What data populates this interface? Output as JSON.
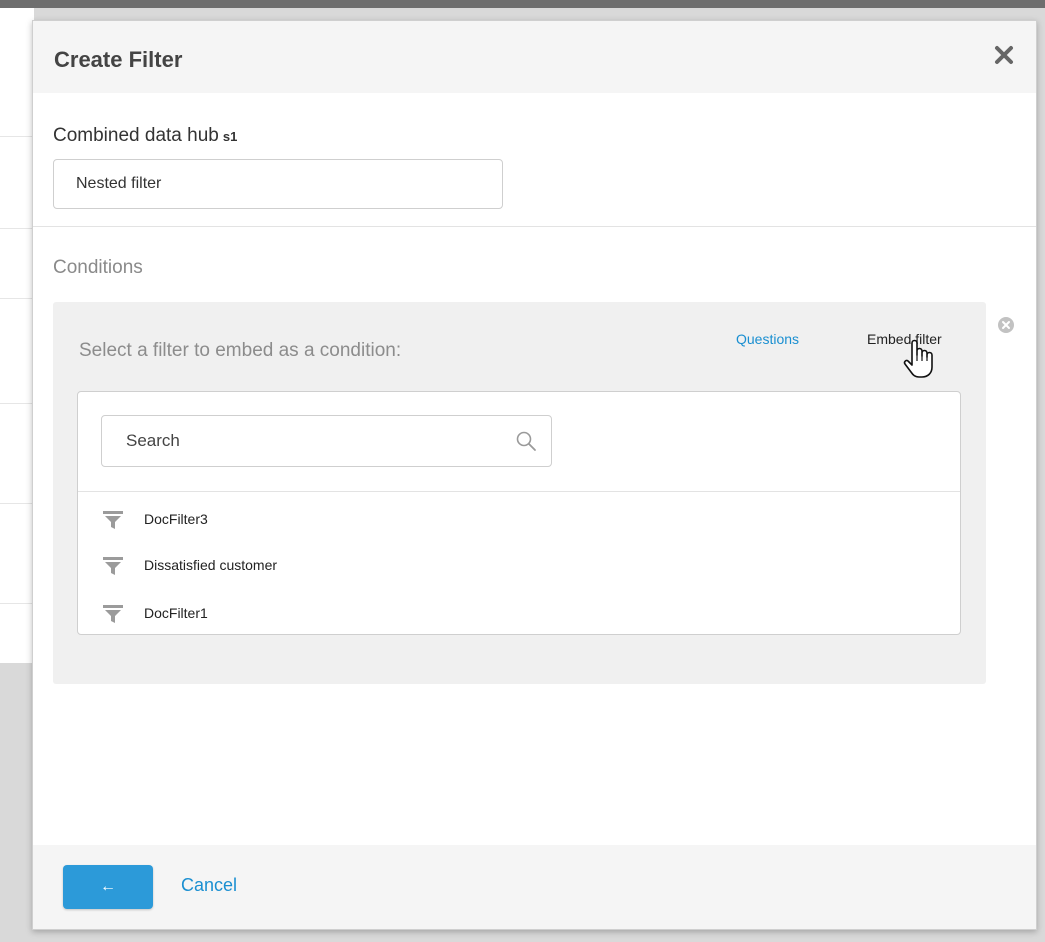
{
  "modal": {
    "title": "Create Filter"
  },
  "form": {
    "hub_label": "Combined data hub",
    "hub_sub": "s1",
    "name_value": "Nested filter"
  },
  "conditions": {
    "label": "Conditions",
    "prompt": "Select a filter to embed as a condition:",
    "tabs": {
      "questions": "Questions",
      "embed_filter": "Embed filter"
    },
    "search": {
      "placeholder": "Search"
    },
    "filters": [
      {
        "label": "DocFilter3"
      },
      {
        "label": "Dissatisfied customer"
      },
      {
        "label": "DocFilter1"
      }
    ]
  },
  "footer": {
    "back_glyph": "←",
    "cancel_label": "Cancel"
  },
  "colors": {
    "accent": "#2c9ad9",
    "link": "#1a8fd1"
  },
  "icons": [
    "close-icon",
    "remove-condition-icon",
    "search-icon",
    "filter-funnel-icon",
    "hand-cursor-icon",
    "arrow-left-icon"
  ]
}
